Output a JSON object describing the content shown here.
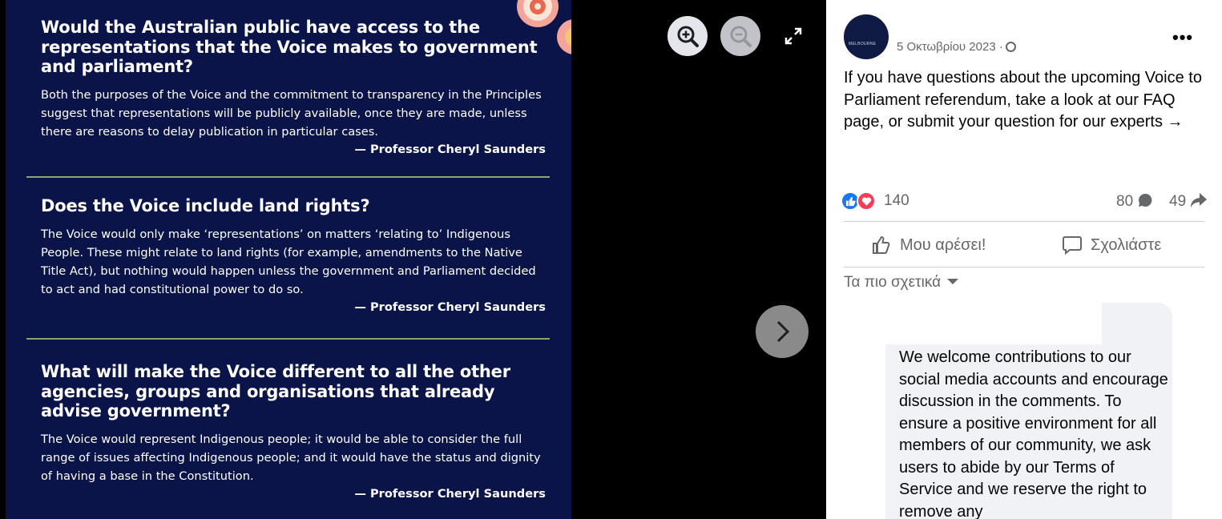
{
  "image": {
    "sections": [
      {
        "question": "Would the Australian public have access to the representations that the Voice makes to government and parliament?",
        "answer": "Both the purposes of the Voice and the commitment to transparency in the Principles suggest that representations will be publicly available, once they are made, unless there are reasons to delay publication in particular cases.",
        "attribution": "— Professor Cheryl Saunders"
      },
      {
        "question": "Does the Voice include land rights?",
        "answer": "The Voice would only make ‘representations’ on matters ‘relating to’ Indigenous People. These might relate to land rights (for example, amendments to the Native Title Act), but nothing would happen unless the government and Parliament decided to act and had constitutional power to do so.",
        "attribution": "— Professor Cheryl Saunders"
      },
      {
        "question": "What will make the Voice different to all the other agencies, groups and organisations that already advise government?",
        "answer": "The Voice would represent Indigenous people; it would be able to consider the full range of issues affecting Indigenous people; and it would have the status and dignity of having a base in the Constitution.",
        "attribution": "— Professor Cheryl Saunders"
      }
    ]
  },
  "viewer": {
    "icons": [
      "zoom-in-icon",
      "zoom-out-icon",
      "expand-icon",
      "chevron-right-icon"
    ]
  },
  "post": {
    "avatar_text": "MELBOURNE",
    "date": "5 Οκτωβρίου 2023 ·",
    "text": "If you have questions about the upcoming Voice to Parliament referendum, take a look at our FAQ page, or submit your question for our experts →",
    "reactions_count": "140",
    "comments_count": "80",
    "shares_count": "49",
    "like_label": "Μου αρέσει!",
    "comment_label": "Σχολιάστε",
    "sort_label": "Τα πιο σχετικά",
    "comment_text": "We welcome contributions to our social media accounts and encourage discussion in the comments. To ensure a positive environment for all members of our community, we ask users to abide by our Terms of Service and we reserve the right to remove any"
  },
  "colors": {
    "panel_bg": "#0a1448",
    "divider": "#8fa66a",
    "like_blue": "#1877f2",
    "love_red": "#f33e58"
  }
}
